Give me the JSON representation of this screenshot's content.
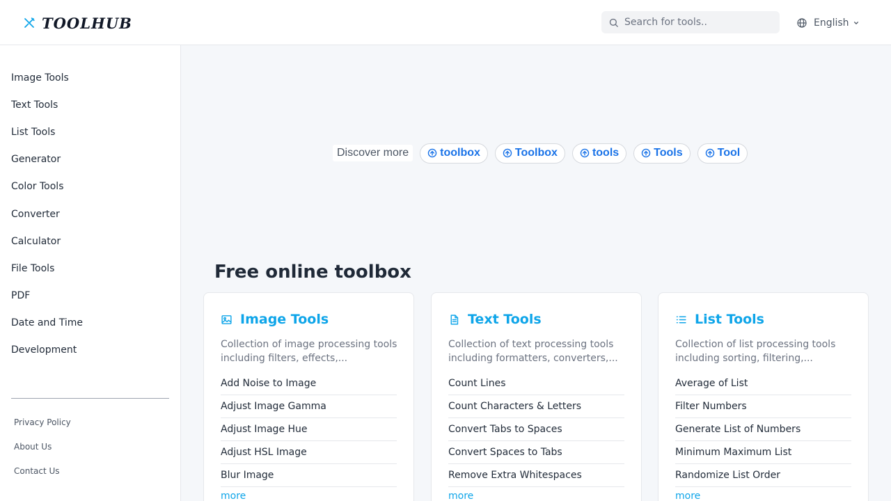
{
  "header": {
    "logo_text": "TOOLHUB",
    "search_placeholder": "Search for tools..",
    "language": "English"
  },
  "sidebar": {
    "items": [
      {
        "label": "Image Tools"
      },
      {
        "label": "Text Tools"
      },
      {
        "label": "List Tools"
      },
      {
        "label": "Generator"
      },
      {
        "label": "Color Tools"
      },
      {
        "label": "Converter"
      },
      {
        "label": "Calculator"
      },
      {
        "label": "File Tools"
      },
      {
        "label": "PDF"
      },
      {
        "label": "Date and Time"
      },
      {
        "label": "Development"
      }
    ],
    "footer_links": [
      {
        "label": "Privacy Policy"
      },
      {
        "label": "About Us"
      },
      {
        "label": "Contact Us"
      }
    ]
  },
  "discover": {
    "label": "Discover more",
    "chips": [
      {
        "label": "toolbox"
      },
      {
        "label": "Toolbox"
      },
      {
        "label": "tools"
      },
      {
        "label": "Tools"
      },
      {
        "label": "Tool"
      }
    ]
  },
  "main": {
    "heading": "Free online toolbox",
    "cards": [
      {
        "icon": "image-icon",
        "title": "Image Tools",
        "description": "Collection of image processing tools including filters, effects,...",
        "tools": [
          "Add Noise to Image",
          "Adjust Image Gamma",
          "Adjust Image Hue",
          "Adjust HSL Image",
          "Blur Image"
        ],
        "more_label": "more"
      },
      {
        "icon": "document-icon",
        "title": "Text Tools",
        "description": "Collection of text processing tools including formatters, converters,...",
        "tools": [
          "Count Lines",
          "Count Characters & Letters",
          "Convert Tabs to Spaces",
          "Convert Spaces to Tabs",
          "Remove Extra Whitespaces"
        ],
        "more_label": "more"
      },
      {
        "icon": "list-icon",
        "title": "List Tools",
        "description": "Collection of list processing tools including sorting, filtering,...",
        "tools": [
          "Average of List",
          "Filter Numbers",
          "Generate List of Numbers",
          "Minimum Maximum List",
          "Randomize List Order"
        ],
        "more_label": "more"
      }
    ]
  },
  "colors": {
    "accent": "#0ea5e9",
    "chip_text": "#1a73e8",
    "background": "#f5f7fa"
  }
}
